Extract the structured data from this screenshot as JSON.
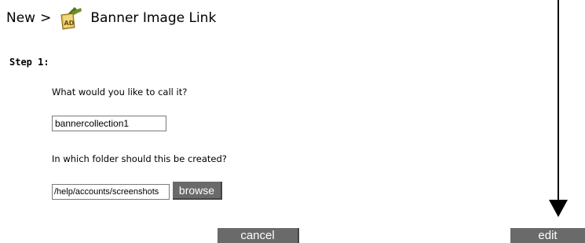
{
  "header": {
    "crumb": "New",
    "separator": ">",
    "title": "Banner Image Link",
    "logo_icon": "ad-banner-icon",
    "logo_text": "AD"
  },
  "step": {
    "label": "Step 1:"
  },
  "name_field": {
    "question": "What would you like to call it?",
    "value": "bannercollection1"
  },
  "folder_field": {
    "question": "In which folder should this be created?",
    "value": "/help/accounts/screenshots",
    "browse_label": "browse"
  },
  "actions": {
    "cancel_label": "cancel",
    "edit_label": "edit"
  },
  "colors": {
    "button_bg": "#6a6a6a",
    "button_text": "#ffffff",
    "logo_gold": "#d9b24a",
    "logo_green": "#4f6e1e"
  }
}
